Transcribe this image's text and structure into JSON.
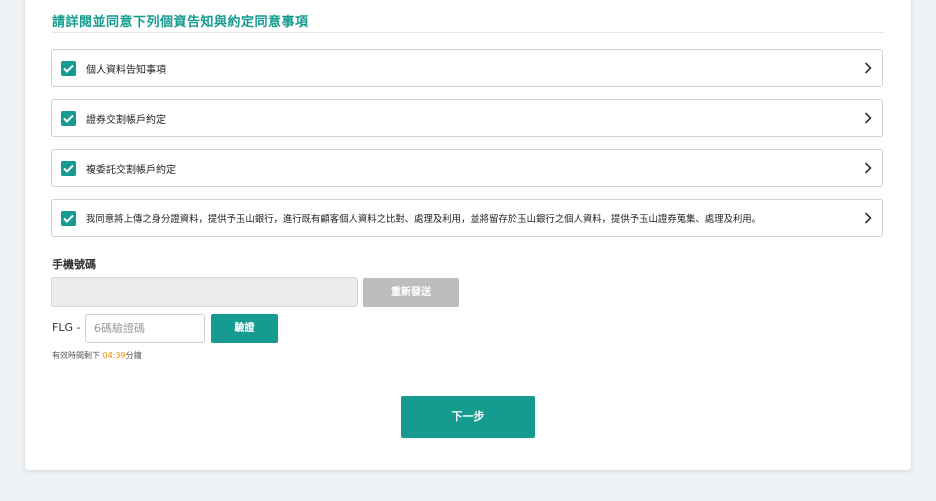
{
  "section": {
    "title": "請詳閱並同意下列個資告知與約定同意事項"
  },
  "agreements": [
    {
      "label": "個人資料告知事項",
      "checked": true
    },
    {
      "label": "證券交割帳戶約定",
      "checked": true
    },
    {
      "label": "複委託交割帳戶約定",
      "checked": true
    },
    {
      "label": "我同意將上傳之身分證資料，提供予玉山銀行，進行既有顧客個人資料之比對、處理及利用，並將留存於玉山銀行之個人資料，提供予玉山證券蒐集、處理及利用。",
      "checked": true
    }
  ],
  "phone": {
    "label": "手機號碼",
    "value": "",
    "resend_label": "重新發送"
  },
  "otp": {
    "prefix": "FLG -",
    "placeholder": "6碼驗證碼",
    "verify_label": "驗證",
    "timer_prefix": "有效時間剩下",
    "timer_value": "04:39",
    "timer_suffix": "分鐘"
  },
  "next_label": "下一步",
  "colors": {
    "accent": "#169b91",
    "timer": "#f08c00",
    "disabled": "#bdbdbd"
  }
}
